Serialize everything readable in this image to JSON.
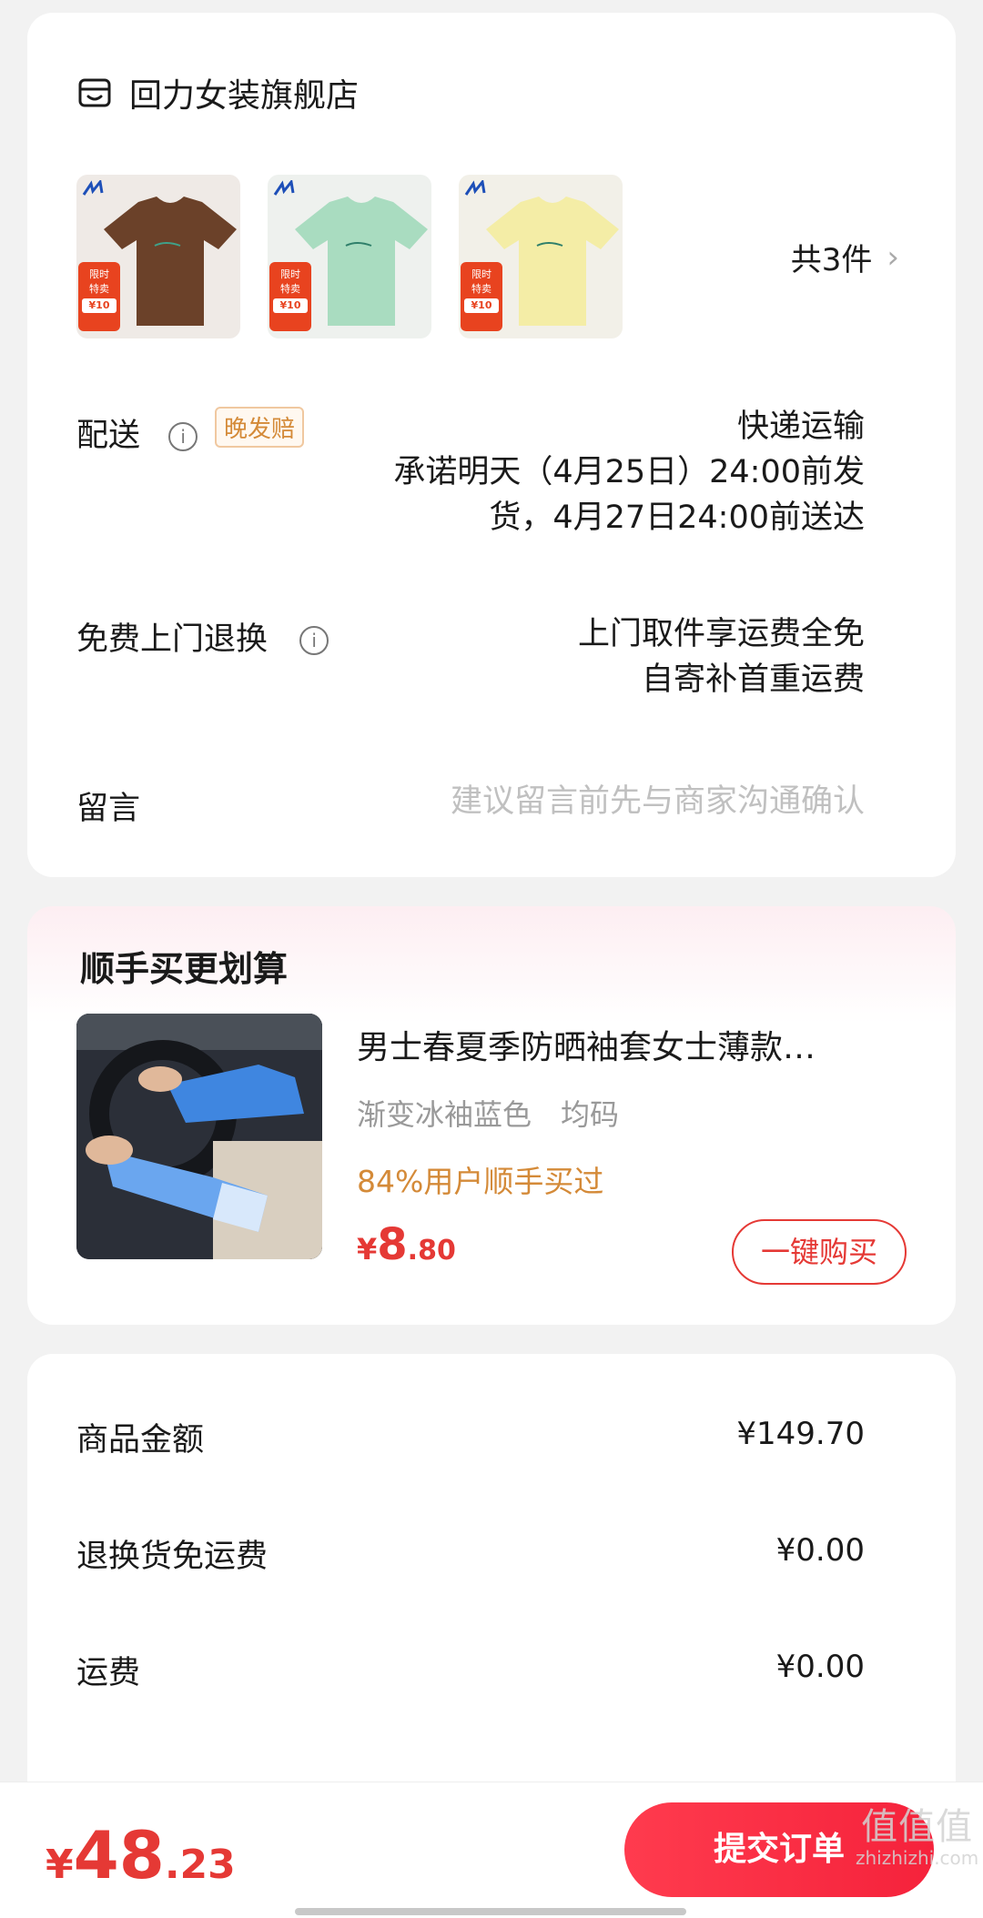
{
  "store": {
    "name": "回力女装旗舰店",
    "items": [
      {
        "color": "#6b4129",
        "promo_line1": "限时",
        "promo_line2": "特卖",
        "promo_price": "¥10"
      },
      {
        "color": "#a9dcc0",
        "promo_line1": "限时",
        "promo_line2": "特卖",
        "promo_price": "¥10"
      },
      {
        "color": "#f4eda6",
        "promo_line1": "限时",
        "promo_line2": "特卖",
        "promo_price": "¥10"
      }
    ],
    "item_count": "共3件",
    "chevron": "›"
  },
  "delivery": {
    "label": "配送",
    "info_icon": "i",
    "tag": "晚发赔",
    "method": "快递运输",
    "promise_line1": "承诺明天（4月25日）24:00前发",
    "promise_line2": "货，4月27日24:00前送达"
  },
  "return": {
    "label": "免费上门退换",
    "info_icon": "i",
    "line1": "上门取件享运费全免",
    "line2": "自寄补首重运费"
  },
  "message": {
    "label": "留言",
    "placeholder": "建议留言前先与商家沟通确认"
  },
  "recommend": {
    "title": "顺手买更划算",
    "product_name": "男士春夏季防晒袖套女士薄款…",
    "spec": "渐变冰袖蓝色　均码",
    "social": "84%用户顺手买过",
    "price_symbol": "¥",
    "price_int": "8",
    "price_dec": ".80",
    "buy_label": "一键购买"
  },
  "summary": {
    "rows": [
      {
        "label": "商品金额",
        "value": "¥149.70"
      },
      {
        "label": "退换货免运费",
        "value": "¥0.00"
      },
      {
        "label": "运费",
        "value": "¥0.00"
      }
    ]
  },
  "bottom": {
    "total_symbol": "¥",
    "total_int": "48",
    "total_dec": ".23",
    "submit_label": "提交订单",
    "watermark_big": "值值值",
    "watermark_small": "zhizhizhi.com"
  }
}
